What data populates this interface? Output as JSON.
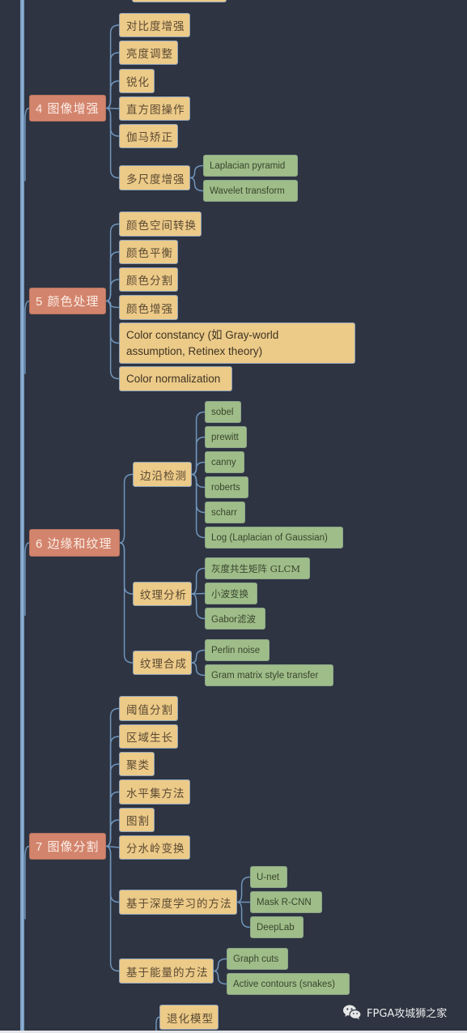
{
  "colors": {
    "background": "#2e3441",
    "connector": "#6f94bb",
    "root_node": "#d3846c",
    "level1_node": "#ecca88",
    "level2_node": "#9fbd88"
  },
  "sections": [
    {
      "label": "4 图像增强",
      "children": [
        {
          "label": "对比度增强"
        },
        {
          "label": "亮度调整"
        },
        {
          "label": "锐化"
        },
        {
          "label": "直方图操作"
        },
        {
          "label": "伽马矫正"
        },
        {
          "label": "多尺度增强",
          "children": [
            {
              "label": "Laplacian pyramid"
            },
            {
              "label": "Wavelet transform"
            }
          ]
        }
      ]
    },
    {
      "label": "5 颜色处理",
      "children": [
        {
          "label": "颜色空间转换"
        },
        {
          "label": "颜色平衡"
        },
        {
          "label": "颜色分割"
        },
        {
          "label": "颜色增强"
        },
        {
          "label": "Color constancy (如 Gray-world assumption, Retinex theory)"
        },
        {
          "label": "Color normalization"
        }
      ]
    },
    {
      "label": "6 边缘和纹理",
      "children": [
        {
          "label": "边沿检测",
          "children": [
            {
              "label": "sobel"
            },
            {
              "label": "prewitt"
            },
            {
              "label": "canny"
            },
            {
              "label": "roberts"
            },
            {
              "label": "scharr"
            },
            {
              "label": "Log (Laplacian of Gaussian)"
            }
          ]
        },
        {
          "label": "纹理分析",
          "children": [
            {
              "label": "灰度共生矩阵 GLCM"
            },
            {
              "label": "小波变换"
            },
            {
              "label": "Gabor滤波"
            }
          ]
        },
        {
          "label": "纹理合成",
          "children": [
            {
              "label": "Perlin noise"
            },
            {
              "label": "Gram matrix style transfer"
            }
          ]
        }
      ]
    },
    {
      "label": "7 图像分割",
      "children": [
        {
          "label": "阈值分割"
        },
        {
          "label": "区域生长"
        },
        {
          "label": "聚类"
        },
        {
          "label": "水平集方法"
        },
        {
          "label": "图割"
        },
        {
          "label": "分水岭变换"
        },
        {
          "label": "基于深度学习的方法",
          "children": [
            {
              "label": "U-net"
            },
            {
              "label": "Mask R-CNN"
            },
            {
              "label": "DeepLab"
            }
          ]
        },
        {
          "label": "基于能量的方法",
          "children": [
            {
              "label": "Graph cuts"
            },
            {
              "label": "Active contours (snakes)"
            }
          ]
        }
      ]
    }
  ],
  "next_section_partial": {
    "first_child_label": "退化模型"
  },
  "watermark": {
    "icon": "wechat-icon",
    "text": "FPGA攻城狮之家"
  }
}
